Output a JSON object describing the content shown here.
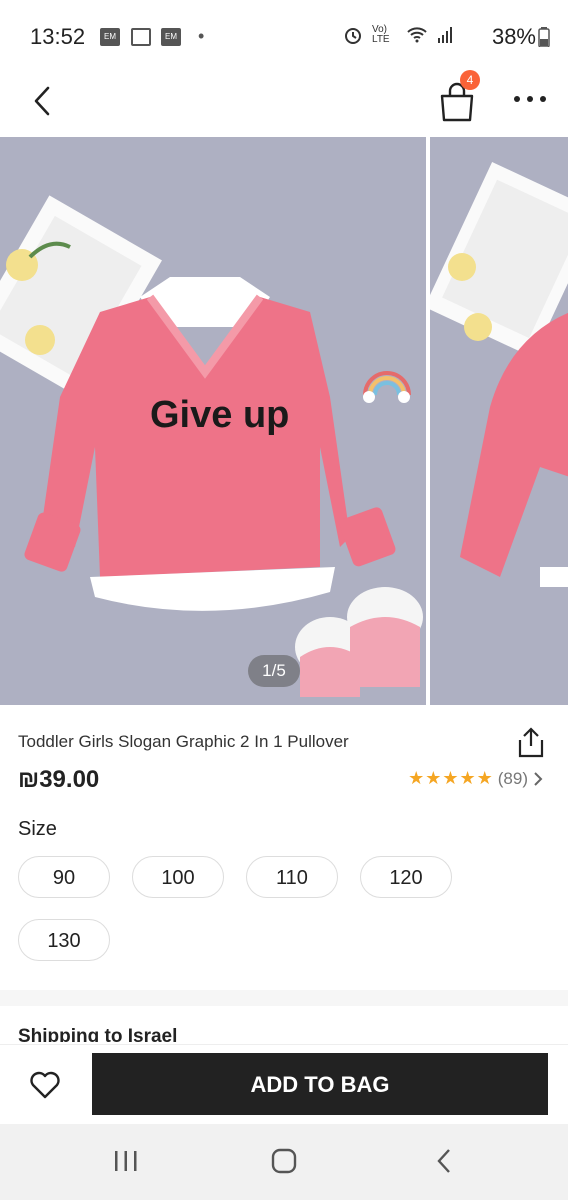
{
  "status_bar": {
    "time": "13:52",
    "notif_1": "EM",
    "notif_2": "EM",
    "battery": "38%",
    "signal_text": "Vo) LTE"
  },
  "header": {
    "cart_count": "4"
  },
  "gallery": {
    "indicator": "1/5",
    "print_text": "Give up"
  },
  "product": {
    "title": "Toddler Girls Slogan Graphic 2 In 1 Pullover",
    "price": "₪39.00",
    "stars": "★★★★★",
    "review_count": "(89)"
  },
  "size": {
    "label": "Size",
    "options": [
      "90",
      "100",
      "110",
      "120",
      "130"
    ]
  },
  "shipping": {
    "label": "Shipping to Israel"
  },
  "actions": {
    "add_to_bag": "ADD TO BAG"
  },
  "colors": {
    "accent_badge": "#fa6338",
    "star": "#f5a623",
    "button": "#222222",
    "image_bg": "#aeb0c2",
    "sweater": "#ee7388"
  }
}
